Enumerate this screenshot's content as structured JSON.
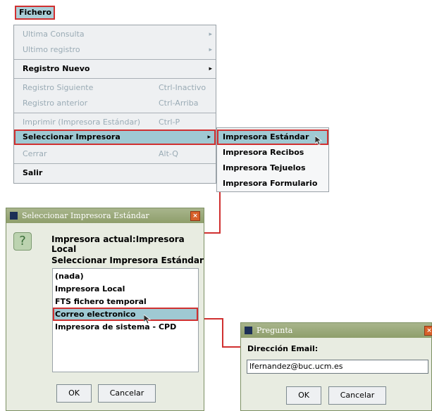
{
  "menu": {
    "title": "Fichero",
    "items": [
      {
        "label": "Ultima Consulta",
        "accel": "",
        "arrow": "▸",
        "disabled": true
      },
      {
        "label": "Ultimo registro",
        "accel": "",
        "arrow": "▸",
        "disabled": true
      },
      {
        "label": "Registro Nuevo",
        "accel": "",
        "arrow": "▸",
        "disabled": false
      },
      {
        "label": "Registro Siguiente",
        "accel": "Ctrl-Inactivo",
        "arrow": "",
        "disabled": true
      },
      {
        "label": "Registro anterior",
        "accel": "Ctrl-Arriba",
        "arrow": "",
        "disabled": true
      },
      {
        "label": "Imprimir (Impresora Estándar)",
        "accel": "Ctrl-P",
        "arrow": "",
        "disabled": true
      },
      {
        "label": "Seleccionar Impresora",
        "accel": "",
        "arrow": "▸",
        "disabled": false,
        "selected": true
      },
      {
        "label": "Cerrar",
        "accel": "Alt-Q",
        "arrow": "",
        "disabled": true
      },
      {
        "label": "Salir",
        "accel": "",
        "arrow": "",
        "disabled": false
      }
    ]
  },
  "submenu": {
    "items": [
      {
        "label": "Impresora Estándar",
        "selected": true
      },
      {
        "label": "Impresora Recibos"
      },
      {
        "label": "Impresora Tejuelos"
      },
      {
        "label": "Impresora Formulario"
      }
    ]
  },
  "dialog_printer": {
    "title": "Seleccionar Impresora Estándar",
    "close_glyph": "×",
    "current_label": "Impresora actual:Impresora Local",
    "select_label": "Seleccionar Impresora Estándar",
    "options": [
      {
        "label": "(nada)"
      },
      {
        "label": "Impresora Local"
      },
      {
        "label": "FTS fichero temporal"
      },
      {
        "label": "Correo electronico",
        "selected": true
      },
      {
        "label": "Impresora de sistema - CPD"
      }
    ],
    "ok_label": "OK",
    "cancel_label": "Cancelar"
  },
  "dialog_email": {
    "title": "Pregunta",
    "field_label": "Dirección Email:",
    "field_value": "lfernandez@buc.ucm.es",
    "ok_label": "OK",
    "cancel_label": "Cancelar"
  },
  "colors": {
    "highlight": "#9fc9d3",
    "callout_red": "#d03030",
    "disabled_text": "#9aabb5",
    "dialog_title": "#8e9e6b"
  },
  "icons": {
    "question": "question-icon",
    "close": "close-icon",
    "app": "app-icon",
    "submenu_arrow": "chevron-right-icon",
    "cursor": "mouse-pointer-icon"
  }
}
